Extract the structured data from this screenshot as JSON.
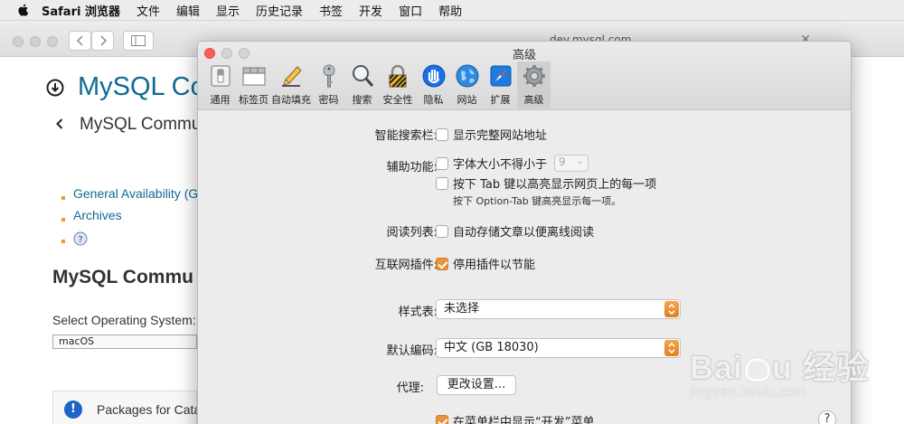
{
  "menubar": {
    "app": "Safari 浏览器",
    "items": [
      "文件",
      "编辑",
      "显示",
      "历史记录",
      "书签",
      "开发",
      "窗口",
      "帮助"
    ]
  },
  "browser": {
    "url": "dev.mysql.com"
  },
  "page": {
    "title": "MySQL Co",
    "breadcrumb": "MySQL Commu",
    "links": [
      "General Availability (G",
      "Archives"
    ],
    "section_title": "MySQL Commu",
    "os_label": "Select Operating System:",
    "os_value": "macOS",
    "packages_text": "Packages for Cata"
  },
  "prefs": {
    "window_title": "高级",
    "tabs": [
      {
        "label": "通用",
        "icon": "general-switch-icon"
      },
      {
        "label": "标签页",
        "icon": "tabs-window-icon"
      },
      {
        "label": "自动填充",
        "icon": "pencil-icon"
      },
      {
        "label": "密码",
        "icon": "key-icon"
      },
      {
        "label": "搜索",
        "icon": "magnifier-icon"
      },
      {
        "label": "安全性",
        "icon": "lock-icon"
      },
      {
        "label": "隐私",
        "icon": "hand-icon"
      },
      {
        "label": "网站",
        "icon": "globe-icon"
      },
      {
        "label": "扩展",
        "icon": "puzzle-compass-icon"
      },
      {
        "label": "高级",
        "icon": "gear-icon"
      }
    ],
    "active_tab": "高级",
    "smart_search": {
      "label": "智能搜索栏:",
      "checkbox": "显示完整网站地址",
      "checked": false
    },
    "accessibility": {
      "label": "辅助功能:",
      "min_font": "字体大小不得小于",
      "min_font_value": "9",
      "tab_highlight": "按下 Tab 键以高亮显示网页上的每一项",
      "note": "按下 Option-Tab 键高亮显示每一项。"
    },
    "reading_list": {
      "label": "阅读列表:",
      "checkbox": "自动存储文章以便离线阅读",
      "checked": false
    },
    "internet_plugins": {
      "label": "互联网插件:",
      "checkbox": "停用插件以节能",
      "checked": true
    },
    "style_sheet": {
      "label": "样式表:",
      "value": "未选择"
    },
    "default_encoding": {
      "label": "默认编码:",
      "value": "中文 (GB 18030)"
    },
    "proxies": {
      "label": "代理:",
      "button": "更改设置..."
    },
    "develop_menu": {
      "checkbox": "在菜单栏中显示“开发”菜单",
      "checked": true
    },
    "help": "?"
  },
  "colors": {
    "accent": "#e8923a",
    "link": "#0e6b96"
  }
}
